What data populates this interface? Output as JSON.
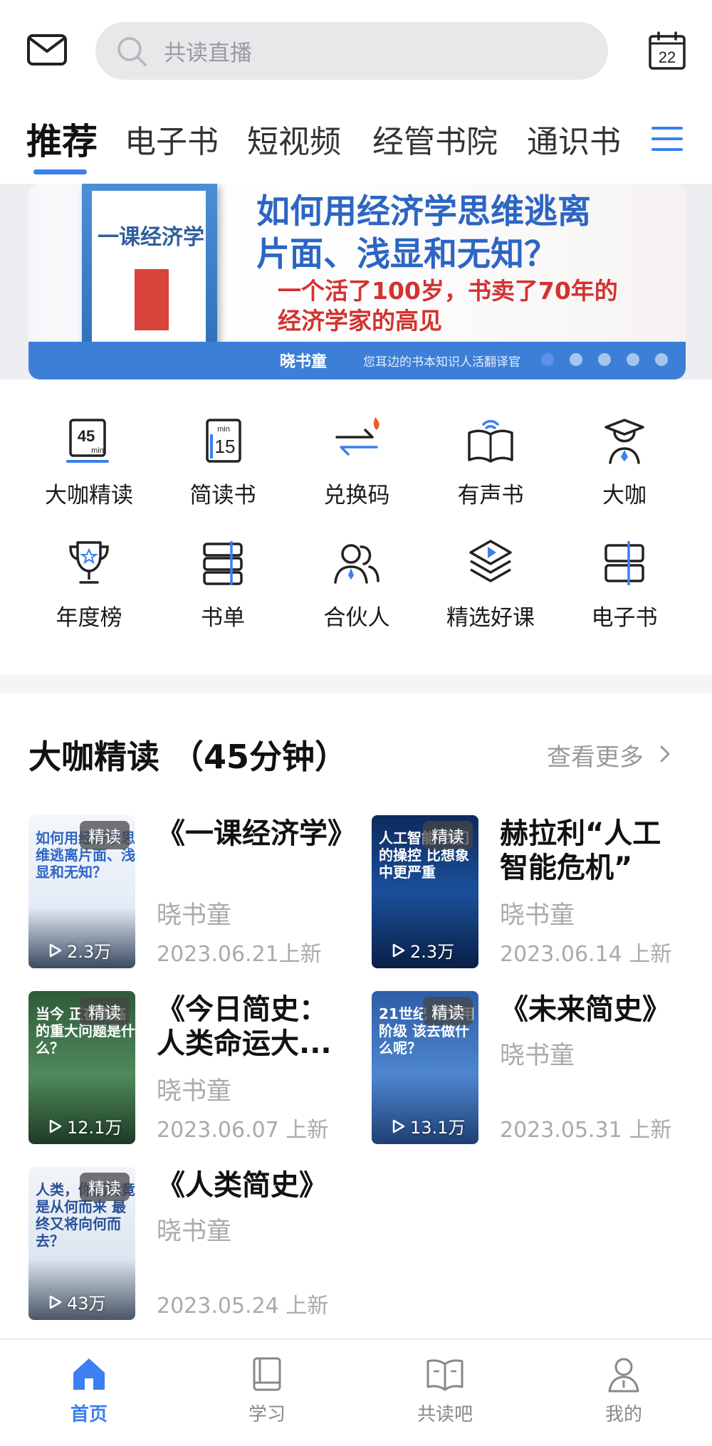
{
  "search": {
    "placeholder": "共读直播"
  },
  "calendar": {
    "day": "22"
  },
  "tabs": [
    {
      "label": "推荐",
      "active": true
    },
    {
      "label": "电子书"
    },
    {
      "label": "短视频"
    },
    {
      "label": "经管书院"
    },
    {
      "label": "通识书"
    }
  ],
  "banner": {
    "book_title": "一课经济学",
    "headline_1": "如何用经济学思维逃离",
    "headline_2": "片面、浅显和无知？",
    "sub_1": "一个活了100岁，书卖了70年的",
    "sub_2": "经济学家的高见",
    "brand": "晓书童",
    "slogan": "您耳边的书本知识人活翻译官",
    "slides": 5,
    "active_slide": 1
  },
  "grid": [
    {
      "label": "大咖精读",
      "icon": "45min-icon"
    },
    {
      "label": "简读书",
      "icon": "15min-icon"
    },
    {
      "label": "兑换码",
      "icon": "exchange-code-icon"
    },
    {
      "label": "有声书",
      "icon": "audiobook-icon"
    },
    {
      "label": "大咖",
      "icon": "expert-icon"
    },
    {
      "label": "年度榜",
      "icon": "trophy-icon"
    },
    {
      "label": "书单",
      "icon": "booklist-icon"
    },
    {
      "label": "合伙人",
      "icon": "partner-icon"
    },
    {
      "label": "精选好课",
      "icon": "course-icon"
    },
    {
      "label": "电子书",
      "icon": "ebook-icon"
    }
  ],
  "section": {
    "title": "大咖精读 （45分钟）",
    "more": "查看更多"
  },
  "cards": [
    {
      "title": "《一课经济学》",
      "author": "晓书童",
      "date": "2023.06.21上新",
      "tag": "精读",
      "plays": "2.3万",
      "cover_text": "如何用经济学思维逃离片面、浅显和无知？"
    },
    {
      "title": "赫拉利“人工智能危机”",
      "author": "晓书童",
      "date": "2023.06.14 上新",
      "tag": "精读",
      "plays": "2.3万",
      "cover_text": "人工智能 我们的操控 比想象中更严重"
    },
    {
      "title": "《今日简史：人类命运大...",
      "author": "晓书童",
      "date": "2023.06.07 上新",
      "tag": "精读",
      "plays": "12.1万",
      "cover_text": "当今 正在面临的重大问题是什么？"
    },
    {
      "title": "《未来简史》",
      "author": "晓书童",
      "date": "2023.05.31 上新",
      "tag": "精读",
      "plays": "13.1万",
      "cover_text": "21世纪 的无用阶级 该去做什么呢？"
    },
    {
      "title": "《人类简史》",
      "author": "晓书童",
      "date": "2023.05.24 上新",
      "tag": "精读",
      "plays": "43万",
      "cover_text": "人类，你们究竟是从何而来 最终又将向何而去？"
    }
  ],
  "bottom_nav": [
    {
      "label": "首页",
      "icon": "home-icon",
      "active": true
    },
    {
      "label": "学习",
      "icon": "study-icon"
    },
    {
      "label": "共读吧",
      "icon": "coread-icon"
    },
    {
      "label": "我的",
      "icon": "profile-icon"
    }
  ],
  "colors": {
    "accent": "#3b7ff0",
    "muted": "#aaaaaa"
  }
}
